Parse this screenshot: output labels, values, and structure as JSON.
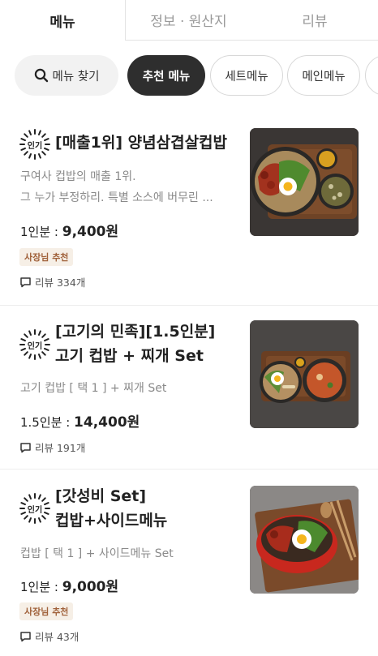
{
  "tabs": [
    {
      "label": "메뉴"
    },
    {
      "label": "정보 · 원산지"
    },
    {
      "label": "리뷰"
    }
  ],
  "chips": {
    "search_label": "메뉴 찾기",
    "recommended": "추천 메뉴",
    "set": "세트메뉴",
    "main": "메인메뉴"
  },
  "items": [
    {
      "badge": "인기",
      "title_lines": [
        "[매출1위] 양념삼겹살컵밥"
      ],
      "desc_lines": [
        "구여사 컵밥의 매출 1위.",
        "그 누가 부정하리. 특별 소스에 버무린 ..."
      ],
      "price_prefix": "1인분 : ",
      "price": "9,400원",
      "owner_tag": "사장님 추천",
      "review": "리뷰 334개"
    },
    {
      "badge": "인기",
      "title_lines": [
        "[고기의 민족][1.5인분]",
        "고기 컵밥 + 찌개 Set"
      ],
      "desc_lines": [
        "고기 컵밥 [ 택 1 ] + 찌개 Set"
      ],
      "price_prefix": "1.5인분 : ",
      "price": "14,400원",
      "review": "리뷰 191개"
    },
    {
      "badge": "인기",
      "title_lines": [
        "[갓성비 Set]",
        "컵밥+사이드메뉴"
      ],
      "desc_lines": [
        "컵밥 [ 택 1 ] + 사이드메뉴 Set"
      ],
      "price_prefix": "1인분 : ",
      "price": "9,000원",
      "owner_tag": "사장님 추천",
      "review": "리뷰 43개"
    }
  ]
}
